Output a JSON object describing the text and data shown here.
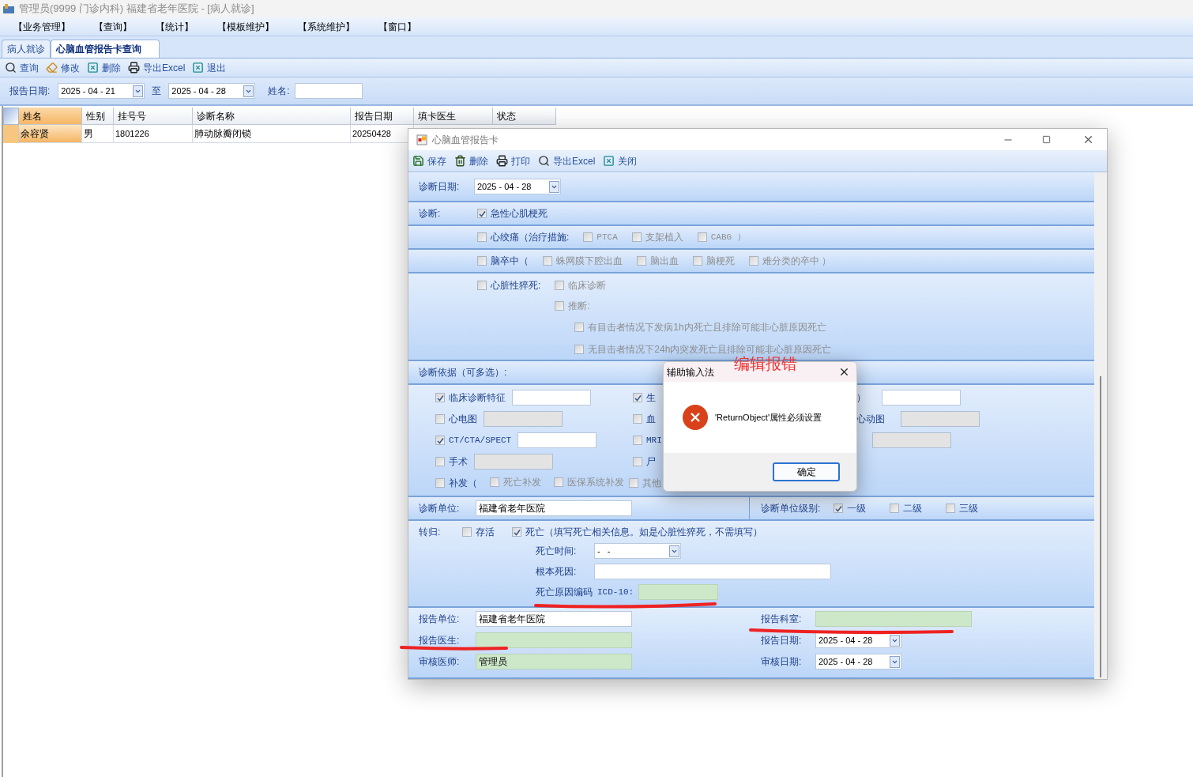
{
  "window": {
    "title": "管理员(9999 门诊内科) 福建省老年医院 - [病人就诊]"
  },
  "menu": [
    "【业务管理】",
    "【查询】",
    "【统计】",
    "【模板维护】",
    "【系统维护】",
    "【窗口】"
  ],
  "tabs": [
    {
      "label": "病人就诊",
      "selected": false
    },
    {
      "label": "心脑血管报告卡查询",
      "selected": true
    }
  ],
  "toolbar": [
    "查询",
    "修改",
    "删除",
    "导出Excel",
    "退出"
  ],
  "filter": {
    "date_label": "报告日期:",
    "from": "2025 - 04 - 21",
    "to_label": "至",
    "to": "2025 - 04 - 28",
    "name_label": "姓名:"
  },
  "table": {
    "columns": [
      "姓名",
      "性别",
      "挂号号",
      "诊断名称",
      "报告日期",
      "填卡医生",
      "状态"
    ],
    "rows": [
      {
        "cells": [
          "余容贤",
          "男",
          "1801226",
          "肺动脉瓣闭锁",
          "20250428"
        ],
        "selected": true
      }
    ]
  },
  "report": {
    "title": "心脑血管报告卡",
    "toolbar": [
      "保存",
      "删除",
      "打印",
      "导出Excel",
      "关闭"
    ],
    "diag_date": {
      "label": "诊断日期:",
      "value": "2025 - 04 - 28"
    },
    "diagnosis_label": "诊断:",
    "diagnosis_rows": [
      {
        "items": [
          {
            "label": "急性心肌梗死",
            "checked": true,
            "disabled": false
          }
        ]
      },
      {
        "items": [
          {
            "label": "心绞痛（治疗措施:",
            "checked": false,
            "disabled": false
          },
          {
            "label": "PTCA",
            "checked": false,
            "disabled": true
          },
          {
            "label": "支架植入",
            "checked": false,
            "disabled": true
          },
          {
            "label": "CABG ）",
            "checked": false,
            "disabled": true
          }
        ]
      },
      {
        "items": [
          {
            "label": "脑卒中（",
            "checked": false,
            "disabled": false
          },
          {
            "label": "蛛网膜下腔出血",
            "checked": false,
            "disabled": true
          },
          {
            "label": "脑出血",
            "checked": false,
            "disabled": true
          },
          {
            "label": "脑梗死",
            "checked": false,
            "disabled": true
          },
          {
            "label": "难分类的卒中 ）",
            "checked": false,
            "disabled": true
          }
        ]
      }
    ],
    "sudden_death": {
      "main": {
        "label": "心脏性猝死:",
        "checked": false,
        "disabled": false
      },
      "options": [
        {
          "label": "临床诊断",
          "checked": false,
          "disabled": true
        },
        {
          "label": "推断:",
          "checked": false,
          "disabled": true
        }
      ],
      "sub": [
        {
          "label": "有目击者情况下发病1h内死亡且排除可能非心脏原因死亡",
          "checked": false,
          "disabled": true
        },
        {
          "label": "无目击者情况下24h内突发死亡且排除可能非心脏原因死亡",
          "checked": false,
          "disabled": true
        }
      ]
    },
    "basis": {
      "title": "诊断依据（可多选）:",
      "rows": [
        {
          "left": {
            "label": "临床诊断特征",
            "checked": true,
            "disabled": false,
            "field_disabled": false
          },
          "middle": {
            "label": "生",
            "checked": true,
            "disabled": false
          },
          "right": {
            "label": "）",
            "field_disabled": false
          }
        },
        {
          "left": {
            "label": "心电图",
            "checked": false,
            "disabled": false,
            "field_disabled": true
          },
          "middle": {
            "label": "血",
            "checked": false,
            "disabled": false
          },
          "right": {
            "label": "心动图",
            "field_disabled": true
          }
        },
        {
          "left": {
            "label": "CT/CTA/SPECT",
            "checked": true,
            "disabled": false,
            "field_disabled": false
          },
          "middle": {
            "label": "MRI",
            "checked": false,
            "disabled": false
          },
          "right": {
            "field_disabled": true
          }
        },
        {
          "left": {
            "label": "手术",
            "checked": false,
            "disabled": false,
            "field_disabled": true
          },
          "middle": {
            "label": "尸",
            "checked": false,
            "disabled": false
          }
        },
        {
          "left": {
            "label": "补发（",
            "checked": false,
            "disabled": false
          },
          "subs": [
            {
              "label": "死亡补发",
              "checked": false,
              "disabled": true
            },
            {
              "label": "医保系统补发",
              "checked": false,
              "disabled": true
            }
          ],
          "middle": {
            "label": "其他",
            "checked": false,
            "disabled": true
          }
        }
      ]
    },
    "unit": {
      "label": "诊断单位:",
      "value": "福建省老年医院",
      "level_label": "诊断单位级别:",
      "levels": [
        {
          "label": "一级",
          "checked": true
        },
        {
          "label": "二级",
          "checked": false
        },
        {
          "label": "三级",
          "checked": false
        }
      ]
    },
    "outcome": {
      "label": "转归:",
      "options": [
        {
          "label": "存活",
          "checked": false
        },
        {
          "label": "死亡（填写死亡相关信息。如是心脏性猝死，不需填写）",
          "checked": true
        }
      ],
      "death_time": {
        "label": "死亡时间:",
        "value": "-   -"
      },
      "cause": {
        "label": "根本死因:",
        "required": false
      },
      "icd": {
        "label": "死亡原因编码",
        "code": "ICD-10:",
        "required": true
      }
    },
    "reporting": {
      "left": [
        {
          "label": "报告单位:",
          "value": "福建省老年医院",
          "required": false
        },
        {
          "label": "报告医生:",
          "required": true
        },
        {
          "label": "审核医师:",
          "value": "管理员",
          "required": true
        }
      ],
      "right": [
        {
          "label": "报告科室:",
          "kind": "text",
          "required": true
        },
        {
          "label": "报告日期:",
          "kind": "date",
          "value": "2025 - 04 - 28"
        },
        {
          "label": "审核日期:",
          "kind": "date",
          "value": "2025 - 04 - 28"
        }
      ]
    }
  },
  "dialog": {
    "title": "辅助输入法",
    "message": "'ReturnObject'属性必须设置",
    "button": "确定"
  },
  "annotation": {
    "text": "编辑报错"
  }
}
